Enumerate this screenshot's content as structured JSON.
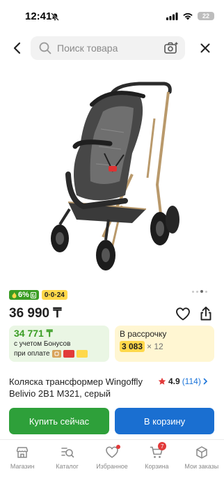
{
  "status_bar": {
    "time": "12:41",
    "battery": "22"
  },
  "search": {
    "placeholder": "Поиск товара"
  },
  "product": {
    "badge_bonus": "6%",
    "badge_installment": "0·0·24",
    "price": "36 990 ₸",
    "bonus_card": {
      "amount": "34 771 ₸",
      "line1": "с учетом Бонусов",
      "line2": "при оплате"
    },
    "installment_card": {
      "title": "В рассрочку",
      "payment": "3 083",
      "months": "× 12"
    },
    "title": "Коляска трансформер Wingoffly Belivio 2В1 M321, серый",
    "rating": "4.9",
    "reviews": "(114)"
  },
  "actions": {
    "buy_now": "Купить сейчас",
    "add_to_cart": "В корзину"
  },
  "nav": {
    "items": [
      {
        "label": "Магазин",
        "icon": "shop-icon"
      },
      {
        "label": "Каталог",
        "icon": "catalog-icon"
      },
      {
        "label": "Избранное",
        "icon": "heart-icon"
      },
      {
        "label": "Корзина",
        "icon": "cart-icon"
      },
      {
        "label": "Мои заказы",
        "icon": "orders-icon"
      }
    ],
    "cart_count": "7"
  },
  "colors": {
    "green": "#3a9d23",
    "blue": "#1a6fd1",
    "yellow": "#ffd84a",
    "red": "#e23a3a"
  }
}
